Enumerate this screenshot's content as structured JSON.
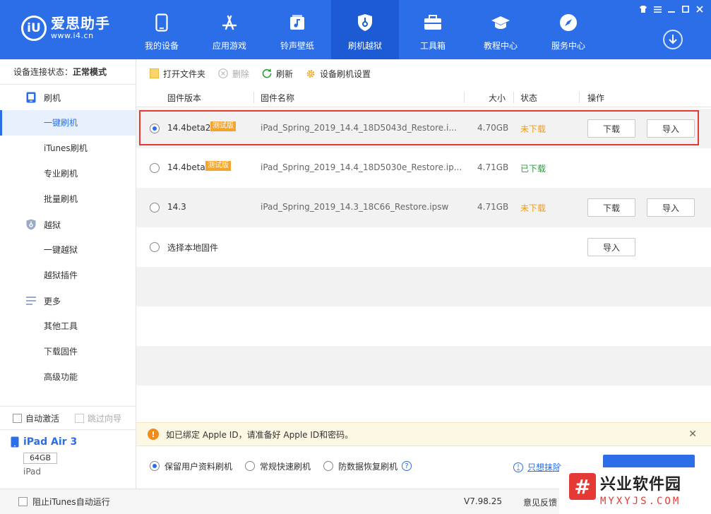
{
  "app": {
    "name": "爱思助手",
    "url": "www.i4.cn"
  },
  "nav": [
    {
      "label": "我的设备",
      "icon": "phone-icon"
    },
    {
      "label": "应用游戏",
      "icon": "app-store-icon"
    },
    {
      "label": "铃声壁纸",
      "icon": "music-icon"
    },
    {
      "label": "刷机越狱",
      "icon": "shield-icon",
      "active": true
    },
    {
      "label": "工具箱",
      "icon": "toolbox-icon"
    },
    {
      "label": "教程中心",
      "icon": "graduation-cap-icon"
    },
    {
      "label": "服务中心",
      "icon": "compass-icon"
    }
  ],
  "sidebar": {
    "status_label": "设备连接状态：",
    "status_value": "正常模式",
    "groups": [
      {
        "label": "刷机",
        "icon": "flash-icon"
      },
      {
        "label": "越狱",
        "icon": "jailbreak-shield-icon"
      },
      {
        "label": "更多",
        "icon": "menu-icon"
      }
    ],
    "items": {
      "flash": [
        "一键刷机",
        "iTunes刷机",
        "专业刷机",
        "批量刷机"
      ],
      "jailbreak": [
        "一键越狱",
        "越狱插件"
      ],
      "more": [
        "其他工具",
        "下载固件",
        "高级功能"
      ]
    },
    "auto_activate": "自动激活",
    "skip_guide": "跳过向导",
    "device": {
      "name": "iPad Air 3",
      "capacity": "64GB",
      "type": "iPad"
    }
  },
  "toolbar": {
    "open_folder": "打开文件夹",
    "delete": "删除",
    "refresh": "刷新",
    "settings": "设备刷机设置"
  },
  "table": {
    "headers": {
      "version": "固件版本",
      "name": "固件名称",
      "size": "大小",
      "status": "状态",
      "action": "操作"
    },
    "rows": [
      {
        "version": "14.4beta2",
        "tag": "测试版",
        "name": "iPad_Spring_2019_14.4_18D5043d_Restore.i...",
        "size": "4.70GB",
        "status": "未下载",
        "download": "下载",
        "import": "导入"
      },
      {
        "version": "14.4beta",
        "tag": "测试版",
        "name": "iPad_Spring_2019_14.4_18D5030e_Restore.ip...",
        "size": "4.71GB",
        "status": "已下载"
      },
      {
        "version": "14.3",
        "name": "iPad_Spring_2019_14.3_18C66_Restore.ipsw",
        "size": "4.71GB",
        "status": "未下载",
        "download": "下载",
        "import": "导入"
      },
      {
        "version": "选择本地固件",
        "import": "导入"
      }
    ]
  },
  "notice": {
    "icon": "!",
    "text": "如已绑定 Apple ID，请准备好 Apple ID和密码。",
    "close": "✕"
  },
  "options": {
    "keep_data": "保留用户资料刷机",
    "quick": "常规快速刷机",
    "recover": "防数据恢复刷机",
    "help": "?",
    "erase_link": "只想抹除"
  },
  "footer": {
    "block_itunes": "阻止iTunes自动运行",
    "version": "V7.98.25",
    "feedback": "意见反馈"
  },
  "watermark": {
    "logo_char": "#",
    "title": "兴业软件园",
    "sub": "MYXYJS.COM"
  },
  "colors": {
    "primary": "#2b6ee8",
    "highlight_box": "#e53935",
    "not_downloaded": "#f09b1a",
    "downloaded": "#2a9d3a",
    "tag": "#f4a52c"
  }
}
